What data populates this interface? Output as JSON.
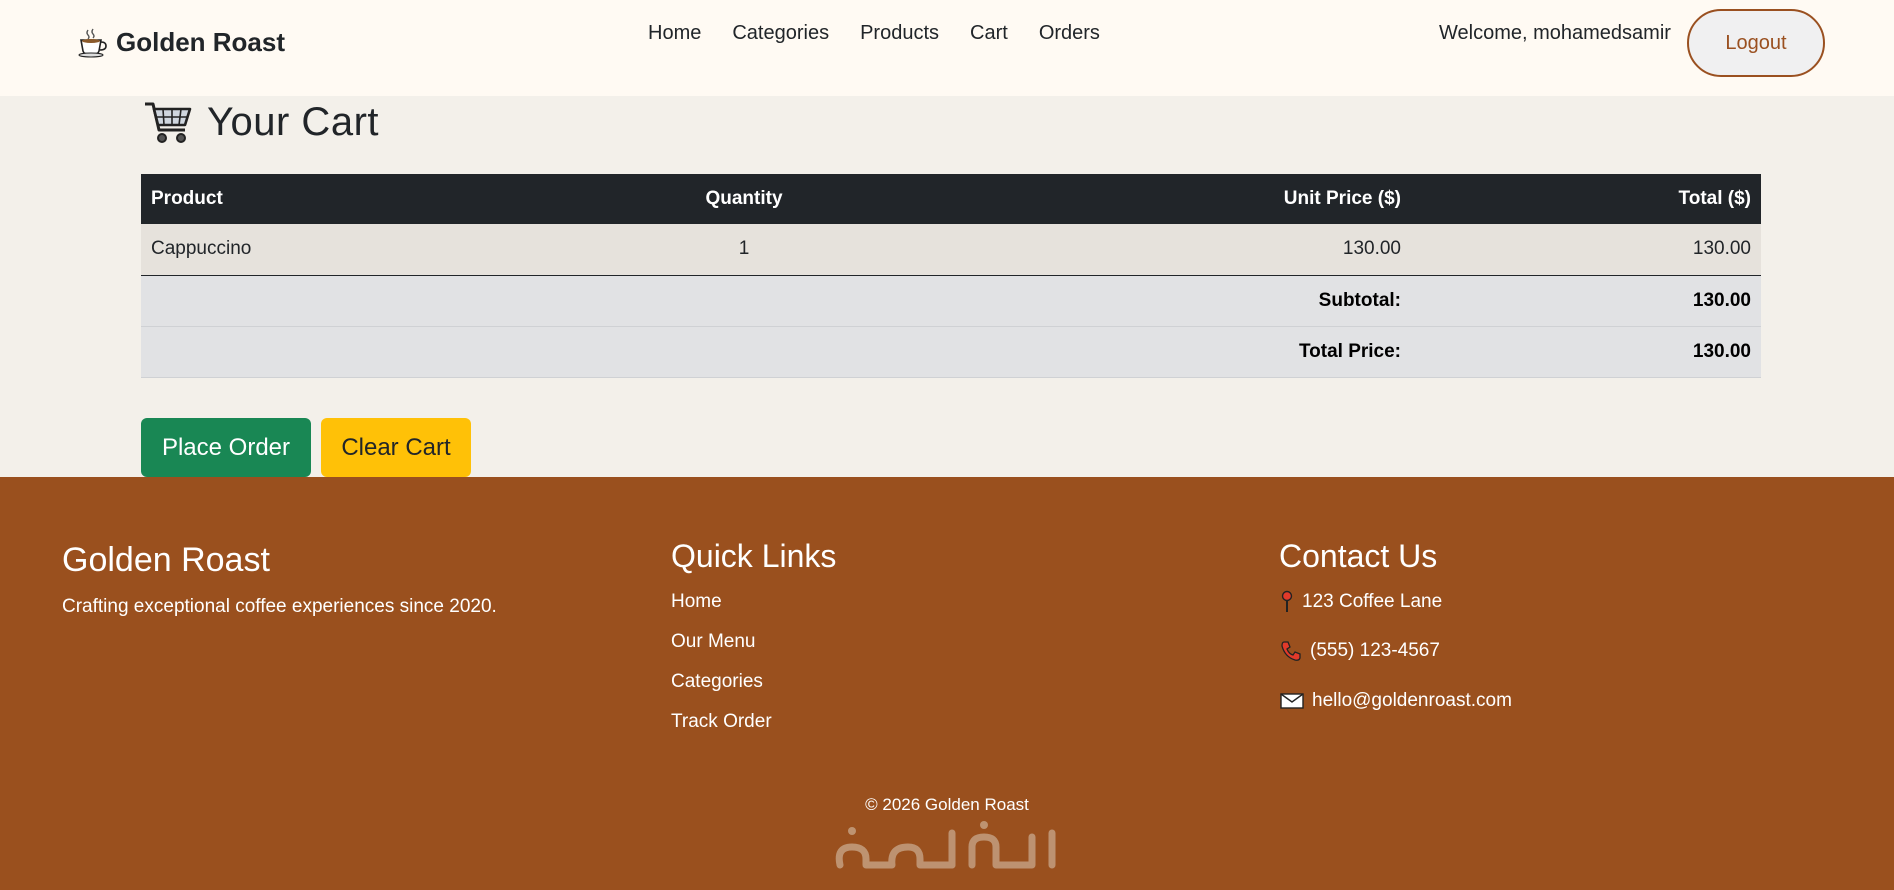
{
  "navbar": {
    "brand": "Golden Roast",
    "links": [
      "Home",
      "Categories",
      "Products",
      "Cart",
      "Orders"
    ],
    "welcome": "Welcome, mohamedsamir",
    "logout": "Logout"
  },
  "cart": {
    "title": "Your Cart",
    "columns": [
      "Product",
      "Quantity",
      "Unit Price ($)",
      "Total ($)"
    ],
    "items": [
      {
        "product": "Cappuccino",
        "quantity": "1",
        "unit_price": "130.00",
        "total": "130.00"
      }
    ],
    "subtotal_label": "Subtotal:",
    "subtotal_value": "130.00",
    "total_label": "Total Price:",
    "total_value": "130.00",
    "place_order": "Place Order",
    "clear_cart": "Clear Cart"
  },
  "footer": {
    "brand": "Golden Roast",
    "tagline": "Crafting exceptional coffee experiences since 2020.",
    "quick_links_title": "Quick Links",
    "quick_links": [
      "Home",
      "Our Menu",
      "Categories",
      "Track Order"
    ],
    "contact_title": "Contact Us",
    "address": "123 Coffee Lane",
    "phone": "(555) 123-4567",
    "email": "hello@goldenroast.com",
    "copyright": "© 2026 Golden Roast",
    "watermark": "خمسات"
  },
  "icons": {
    "brand": "coffee-cup-icon",
    "cart": "shopping-cart-icon",
    "address": "pin-icon",
    "phone": "phone-icon",
    "email": "envelope-icon"
  },
  "colors": {
    "footer_bg": "#9a501e",
    "place_order": "#198754",
    "clear_cart": "#ffc107",
    "table_header": "#212529",
    "logout_border": "#9a5020"
  }
}
